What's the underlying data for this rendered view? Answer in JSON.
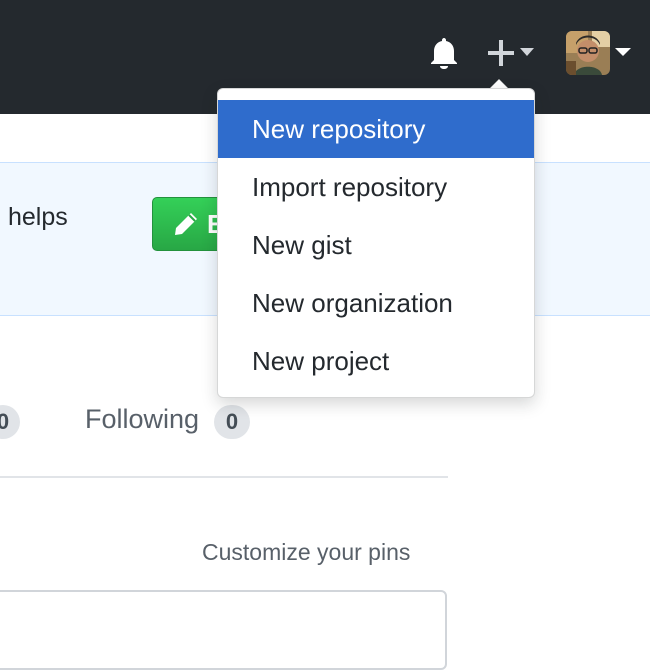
{
  "header": {
    "bell_icon": "bell-icon",
    "plus_icon": "plus-icon",
    "caret_icon": "caret-down-icon",
    "avatar": "user-avatar"
  },
  "banner": {
    "text": "helps",
    "edit_button_label": "E",
    "button_icon": "pencil-icon"
  },
  "counts": {
    "left_count": "0",
    "following_label": "Following",
    "following_count": "0"
  },
  "pins": {
    "customize_label": "Customize your pins"
  },
  "dropdown": {
    "items": [
      {
        "label": "New repository",
        "active": true
      },
      {
        "label": "Import repository",
        "active": false
      },
      {
        "label": "New gist",
        "active": false
      },
      {
        "label": "New organization",
        "active": false
      },
      {
        "label": "New project",
        "active": false
      }
    ]
  },
  "colors": {
    "header_bg": "#24292e",
    "active_item_bg": "#2f6ccc",
    "button_green": "#28a745",
    "banner_bg": "#f1f8ff",
    "badge_bg": "#e1e4e8"
  }
}
